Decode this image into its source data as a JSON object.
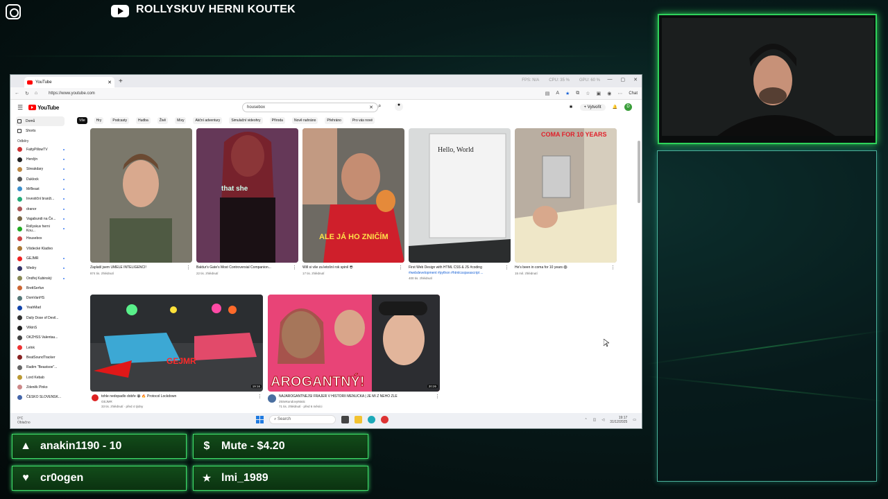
{
  "overlay": {
    "channel_title": "ROLLYSKUV HERNI KOUTEK",
    "alerts": [
      {
        "icon": "flame-icon",
        "glyph": "▲",
        "text": "anakin1190 - 10"
      },
      {
        "icon": "dollar-icon",
        "glyph": "$",
        "text": "Mute - $4.20"
      },
      {
        "icon": "heart-icon",
        "glyph": "♥",
        "text": "cr0ogen"
      },
      {
        "icon": "star-icon",
        "glyph": "★",
        "text": "lmi_1989"
      }
    ],
    "accent": "#2fd25b"
  },
  "browser": {
    "tab_title": "YouTube",
    "url": "https://www.youtube.com",
    "perf": {
      "fps": "FPS: N/A",
      "cpu": "CPU: 35 %",
      "gpu": "GPU: 60 %"
    },
    "chat_label": "Chat"
  },
  "youtube": {
    "logo": "YouTube",
    "search_value": "housebox",
    "create_label": "Vytvořit",
    "avatar_letter": "D",
    "sidebar": {
      "top": [
        {
          "label": "Domů",
          "icon": "home-icon",
          "active": true
        },
        {
          "label": "Shorts",
          "icon": "shorts-icon",
          "active": false
        }
      ],
      "section": "Odběry",
      "subscriptions": [
        {
          "label": "FattyPillowTV",
          "color": "#c33"
        },
        {
          "label": "Herdýn",
          "color": "#222"
        },
        {
          "label": "Streakdary",
          "color": "#b84"
        },
        {
          "label": "Duklock",
          "color": "#555"
        },
        {
          "label": "MrBeast",
          "color": "#3a8ecb"
        },
        {
          "label": "Investiční branži...",
          "color": "#2a7"
        },
        {
          "label": "dranor",
          "color": "#a55"
        },
        {
          "label": "Vagabundi na Če...",
          "color": "#764"
        },
        {
          "label": "Rollyskuv herni Kou...",
          "color": "#2a2"
        },
        {
          "label": "Housebox",
          "color": "#c44"
        },
        {
          "label": "Všidecké Kladivo",
          "color": "#a73"
        },
        {
          "label": "GEJMR",
          "color": "#e22"
        },
        {
          "label": "Wedry",
          "color": "#336"
        },
        {
          "label": "Ondřej Kubinský",
          "color": "#885"
        },
        {
          "label": "BrettSerfun",
          "color": "#c63"
        },
        {
          "label": "DomVanHS",
          "color": "#577"
        },
        {
          "label": "YeahMad",
          "color": "#14a"
        },
        {
          "label": "Daily Dose of Devil...",
          "color": "#333"
        },
        {
          "label": "VilkinS",
          "color": "#222"
        },
        {
          "label": "OKZHSS Valentau...",
          "color": "#444"
        },
        {
          "label": "Lelnk",
          "color": "#e33"
        },
        {
          "label": "BeatSoundTracker",
          "color": "#822"
        },
        {
          "label": "Radim \"Beastsoe\"...",
          "color": "#666"
        },
        {
          "label": "Lord Kebab",
          "color": "#b93"
        },
        {
          "label": "Zdeněk Pinko",
          "color": "#c88"
        },
        {
          "label": "ČESKO SLOVENSK...",
          "color": "#46a"
        }
      ]
    },
    "chips": [
      "Vše",
      "Hry",
      "Podcasty",
      "Hudba",
      "Živě",
      "Mixy",
      "Akční adventury",
      "Simulační videohry",
      "Příroda",
      "Nově nahráno",
      "Přehráno",
      "Pro vás nové"
    ],
    "shorts": [
      {
        "title": "Zaplatil jsem UMĚLÉ INTELIGENCI!",
        "meta": "874 tis. zhlédnutí",
        "caption": ""
      },
      {
        "title": "Baldur's Gate's Most Controversial Companion...",
        "meta": "22 tis. zhlédnutí",
        "caption": "that she"
      },
      {
        "title": "Will si vše za letošní rok spinil 😎",
        "meta": "17 tis. zhlédnutí",
        "caption": "ALE JÁ HO ZNIČÍM"
      },
      {
        "title": "First Web Design with HTML CSS & JS #coding",
        "title2": "#webdevelopment #python #htmlcssjavascript ...",
        "meta": "400 tis. zhlédnutí",
        "caption": "Hello, World"
      },
      {
        "title": "He's been in coma for 10 years 😱",
        "meta": "15 mil. zhlédnutí",
        "caption": "COMA FOR 10 YEARS"
      }
    ],
    "videos": [
      {
        "title": "tohle nedopadlo dobře 😭 🔥 Protocol Lockdown",
        "channel": "GEJMR",
        "meta": "33 tis. zhlédnutí · před 4 týdny",
        "duration": "19:16",
        "caption": "GEJMR"
      },
      {
        "title": "NAJAROGANTNĚJŠÍ FRAJER V HISTORII MENUČKA | JE MI Z NĚHO ZLE",
        "channel": "25SekundovyMatic",
        "meta": "71 tis. zhlédnutí · před 6 měsíci",
        "duration": "20:26",
        "caption": "AROGANTNÝ!"
      }
    ]
  },
  "taskbar": {
    "weather_temp": "0°C",
    "weather_text": "Oblačno",
    "search": "Search",
    "time": "19:17",
    "date": "31/12/2025"
  }
}
